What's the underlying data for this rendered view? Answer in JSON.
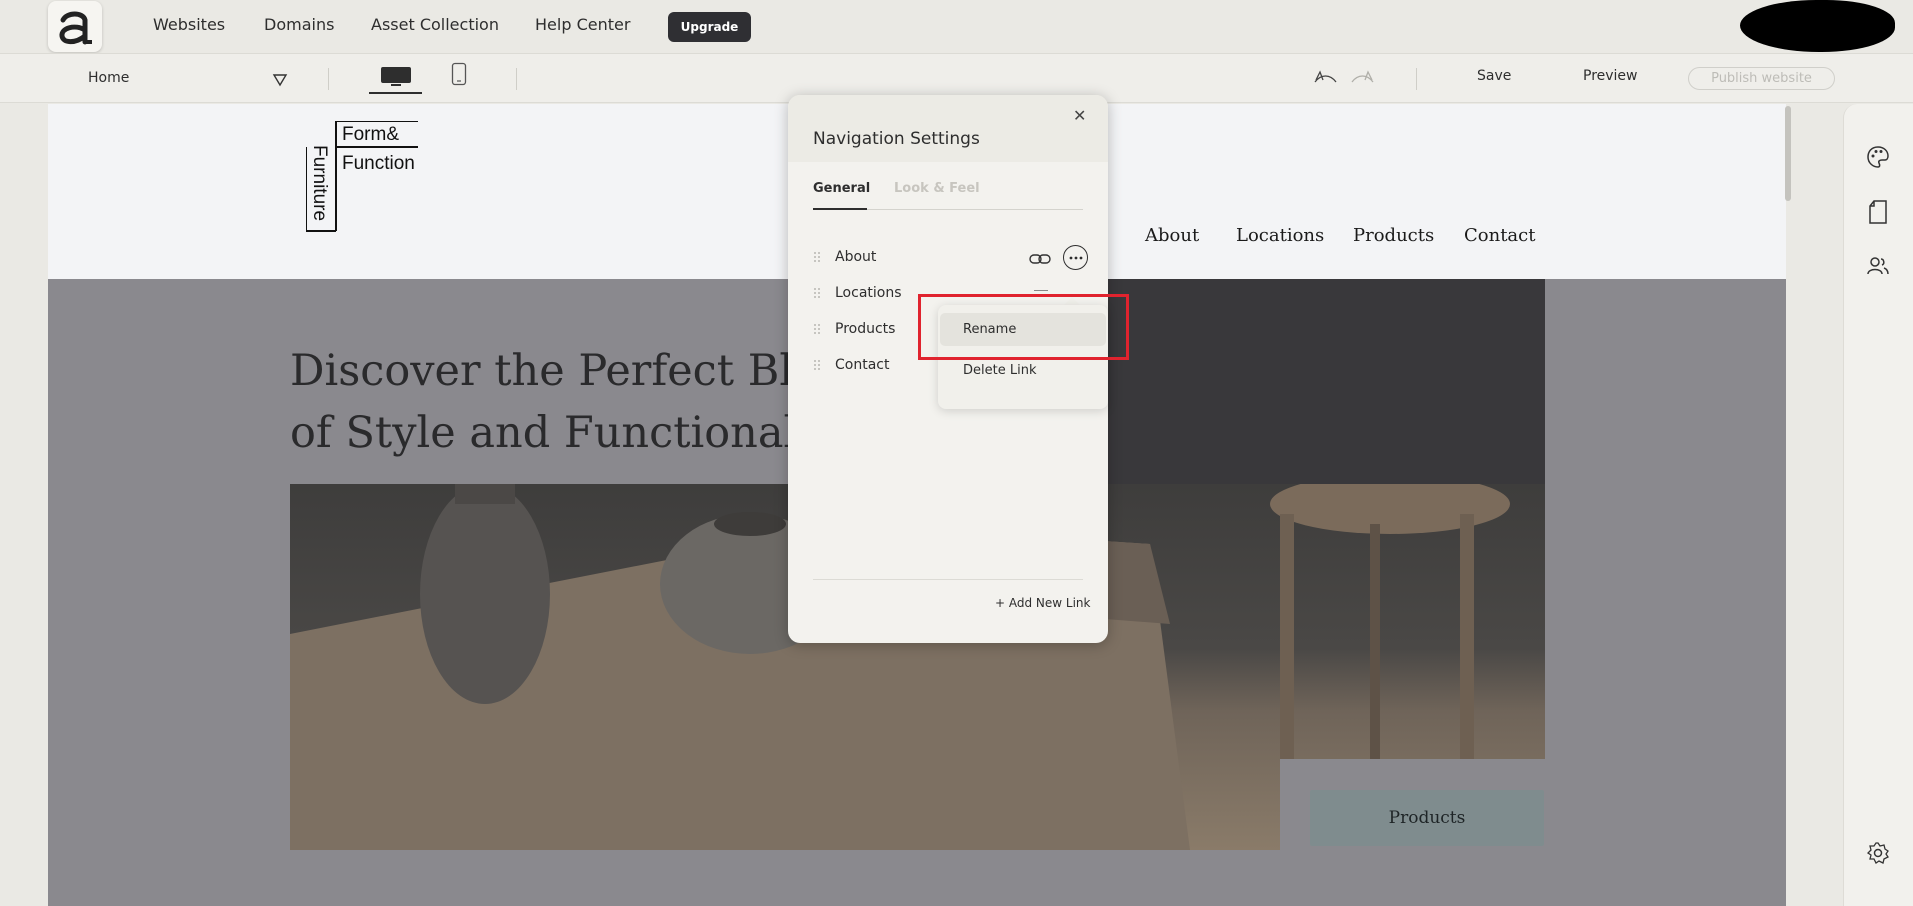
{
  "topbar": {
    "nav": [
      "Websites",
      "Domains",
      "Asset Collection",
      "Help Center"
    ],
    "upgrade_label": "Upgrade"
  },
  "toolbar": {
    "page_select": "Home",
    "save_label": "Save",
    "preview_label": "Preview",
    "publish_label": "Publish website"
  },
  "site": {
    "logo": {
      "line1": "Form&",
      "line2": "Function",
      "vertical": "Furniture"
    },
    "nav": [
      "About",
      "Locations",
      "Products",
      "Contact"
    ],
    "hero_title_line1": "Discover the Perfect Bl",
    "hero_title_line2": "of Style and Functional",
    "cta_label": "Products"
  },
  "nav_panel": {
    "title": "Navigation Settings",
    "tabs": [
      {
        "label": "General",
        "active": true
      },
      {
        "label": "Look & Feel",
        "active": false
      }
    ],
    "links": [
      "About",
      "Locations",
      "Products",
      "Contact"
    ],
    "add_link_label": "+ Add New Link",
    "context_menu": [
      "Rename",
      "Delete Link"
    ]
  },
  "colors": {
    "highlight": "#e0232e",
    "upgrade_bg": "#2f2f33",
    "cta_bg": "#7f8c8e"
  }
}
